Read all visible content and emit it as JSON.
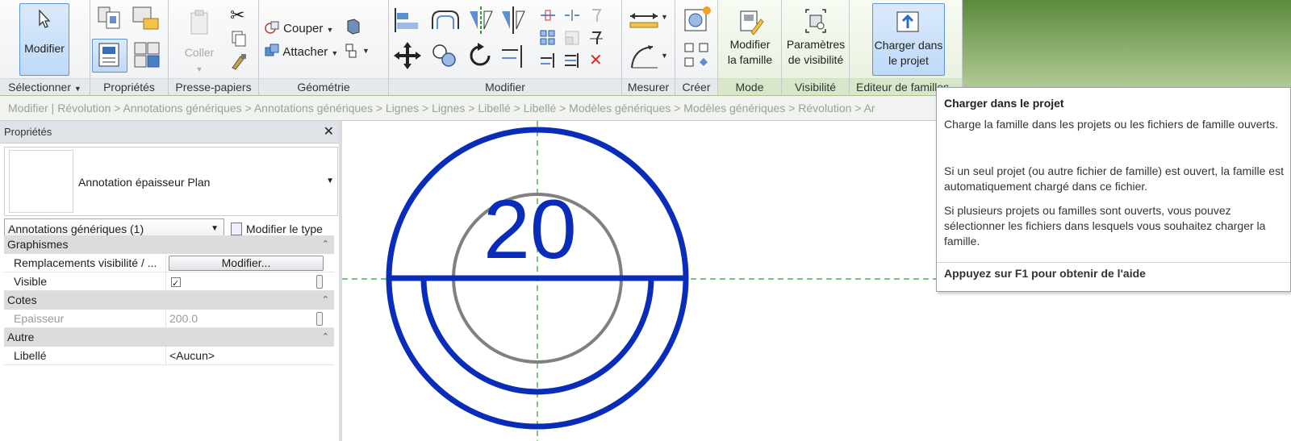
{
  "ribbon": {
    "modifier_button": "Modifier",
    "panels": {
      "selectionner": "Sélectionner",
      "proprietes": "Propriétés",
      "presse_papiers": "Presse-papiers",
      "geometrie": "Géométrie",
      "modifier": "Modifier",
      "mesurer": "Mesurer",
      "creer": "Créer",
      "mode": "Mode",
      "visibilite": "Visibilité",
      "editeur": "Editeur de familles"
    },
    "coller": "Coller",
    "couper": "Couper",
    "attacher": "Attacher",
    "modifier_famille": [
      "Modifier",
      "la famille"
    ],
    "parametres_visibilite": [
      "Paramètres",
      "de visibilité"
    ],
    "charger_projet": [
      "Charger dans",
      "le projet"
    ]
  },
  "breadcrumb": "Modifier | Révolution > Annotations génériques > Annotations génériques > Lignes > Lignes > Libellé > Libellé > Modèles génériques > Modèles génériques > Révolution > Ar",
  "properties": {
    "title": "Propriétés",
    "type_name": "Annotation épaisseur Plan",
    "category": "Annotations génériques (1)",
    "edit_type": "Modifier le type",
    "groups": [
      {
        "name": "Graphismes"
      },
      {
        "name": "Cotes"
      },
      {
        "name": "Autre"
      }
    ],
    "rows": {
      "remplacements": {
        "name": "Remplacements visibilité / ...",
        "button": "Modifier..."
      },
      "visible": {
        "name": "Visible",
        "checked": true
      },
      "epaisseur": {
        "name": "Epaisseur",
        "value": "200.0"
      },
      "libelle": {
        "name": "Libellé",
        "value": "<Aucun>"
      }
    }
  },
  "canvas": {
    "label_value": "20",
    "colors": {
      "blue": "#0a2db9",
      "gray": "#808080",
      "ref_line": "#2e9b2e"
    }
  },
  "tooltip": {
    "title": "Charger dans le projet",
    "p1": "Charge la famille dans les projets ou les fichiers de famille ouverts.",
    "p2": "Si un seul projet (ou autre fichier de famille) est ouvert, la famille est automatiquement chargé dans ce fichier.",
    "p3": "Si plusieurs projets ou familles sont ouverts, vous pouvez sélectionner les fichiers dans lesquels vous souhaitez charger la famille.",
    "help": "Appuyez sur F1 pour obtenir de l'aide"
  }
}
